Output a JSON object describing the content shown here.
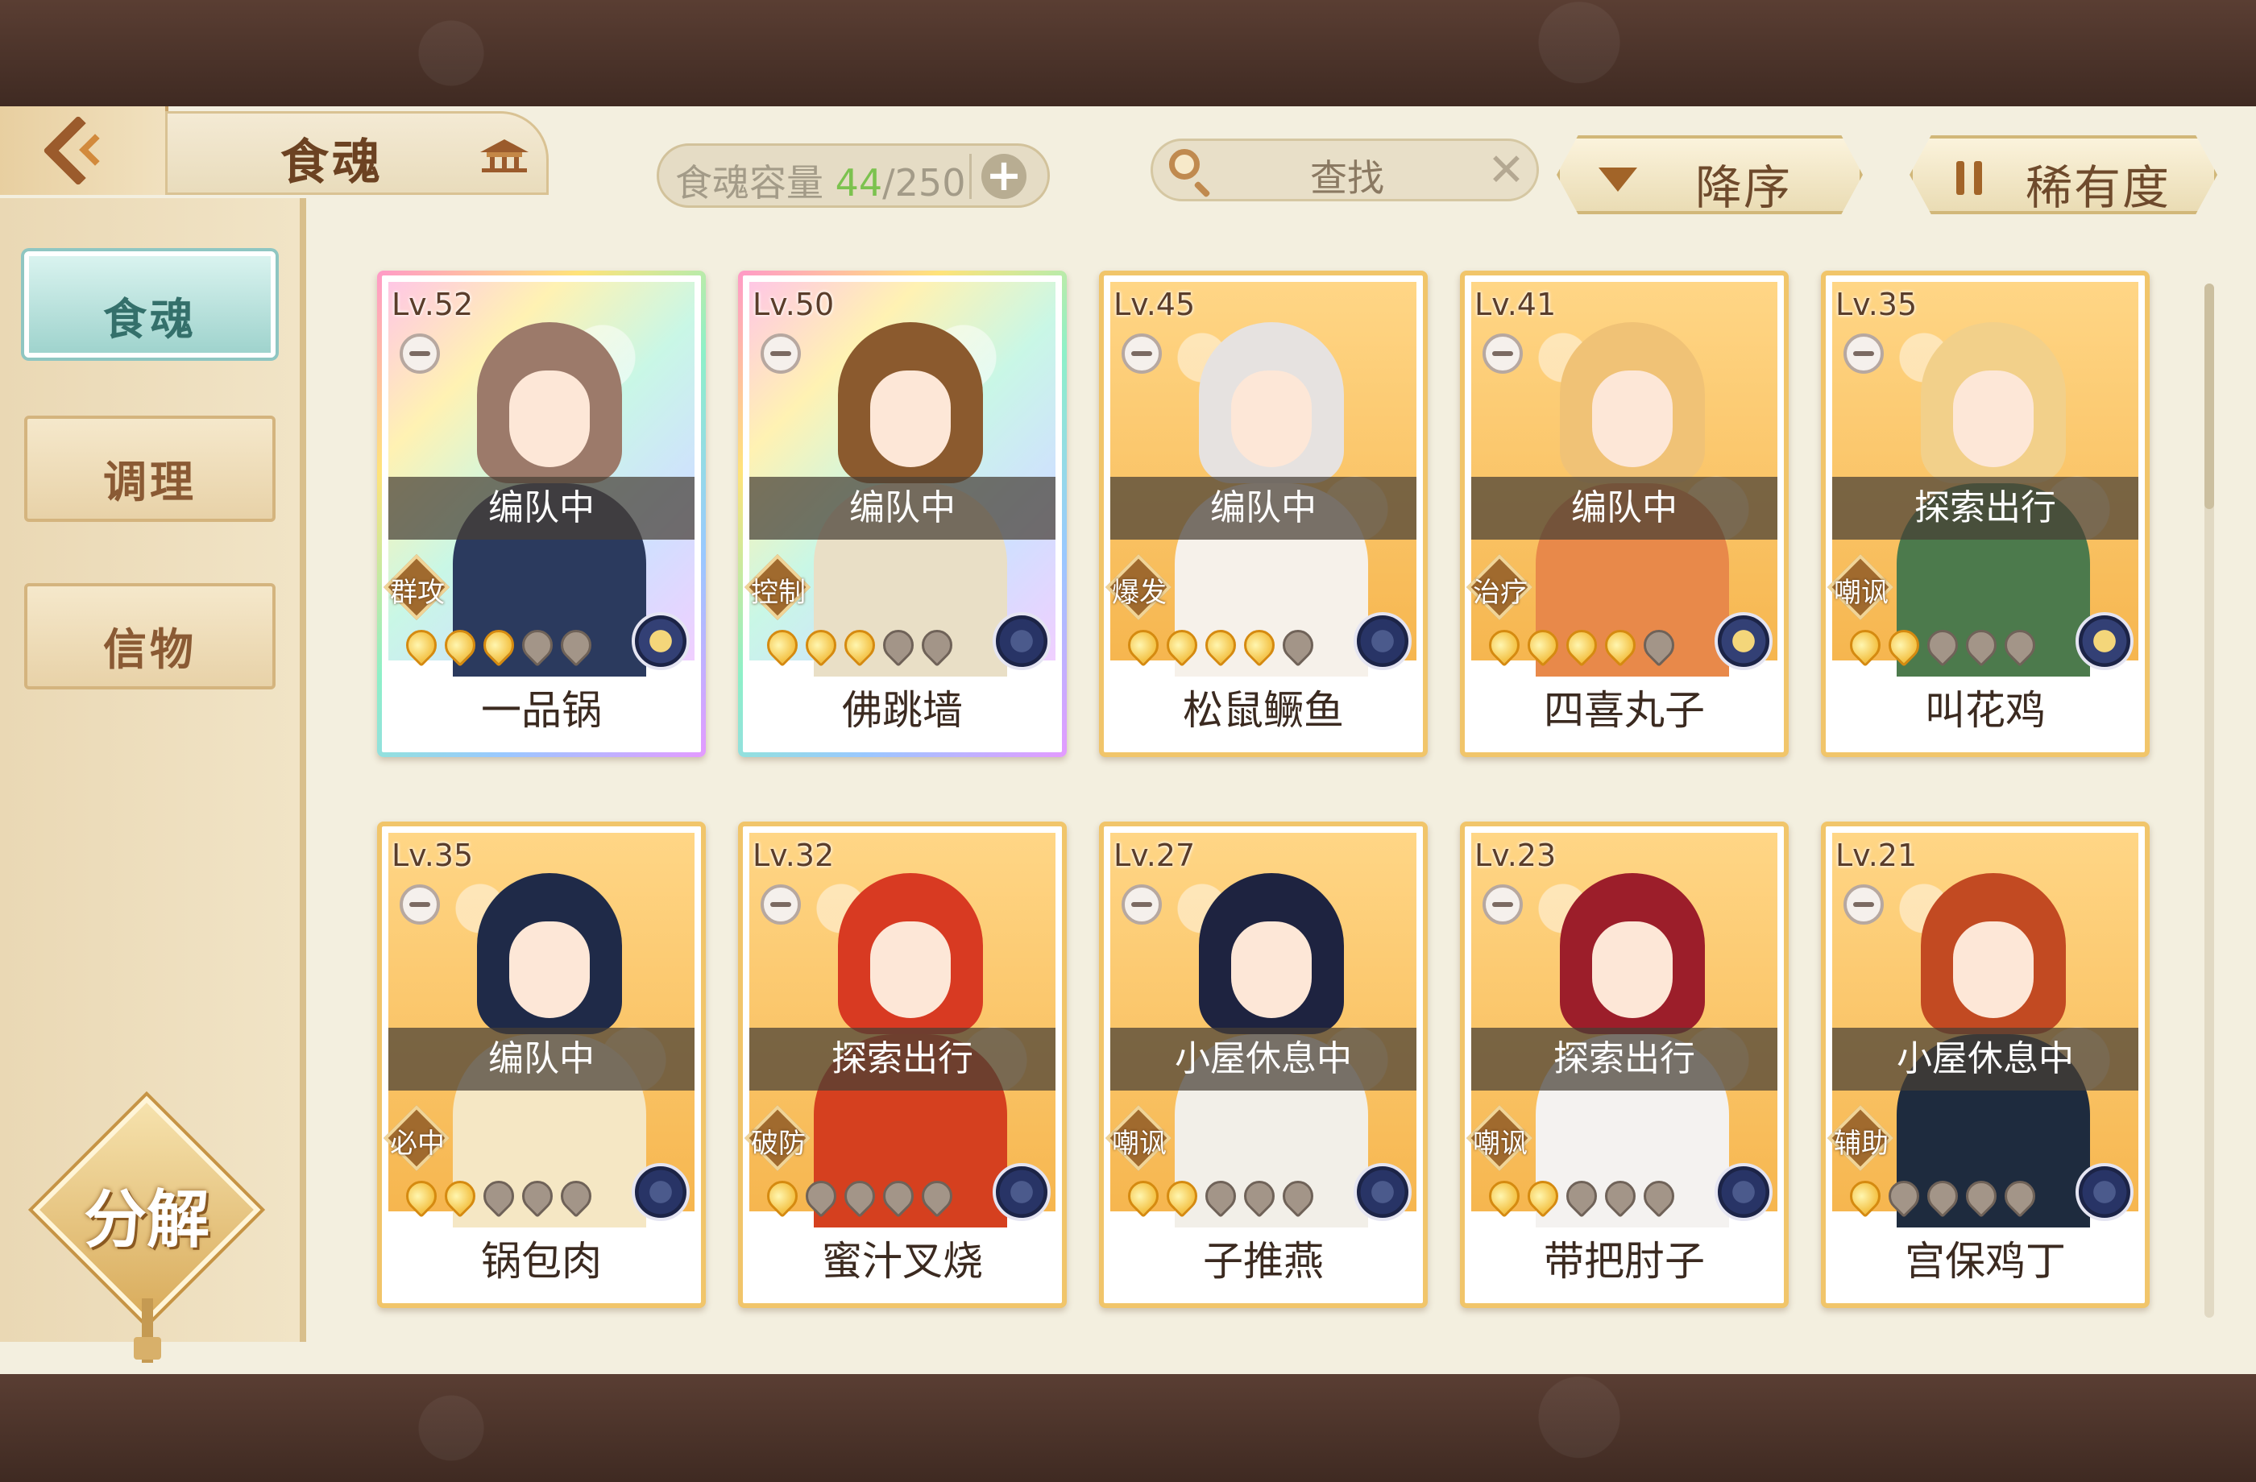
{
  "header": {
    "title": "食魂",
    "capacity_label": "食魂容量",
    "capacity_current": "44",
    "capacity_total": "/250",
    "capacity_add": "+",
    "search_placeholder": "查找",
    "search_clear": "✕",
    "sort_order": "降序",
    "sort_key": "稀有度"
  },
  "sidebar": {
    "items": [
      {
        "label": "食魂",
        "active": true
      },
      {
        "label": "调理",
        "active": false
      },
      {
        "label": "信物",
        "active": false
      }
    ],
    "decompose": "分解"
  },
  "cards": [
    {
      "level": "Lv.52",
      "status": "编队中",
      "role": "群攻",
      "stars": 3,
      "name": "一品锅",
      "frame": "rainbow",
      "emblem": "gold",
      "hair": "#9c7a6a",
      "body": "#2b3a5e"
    },
    {
      "level": "Lv.50",
      "status": "编队中",
      "role": "控制",
      "stars": 3,
      "name": "佛跳墙",
      "frame": "rainbow",
      "emblem": "blue",
      "hair": "#8b5a2e",
      "body": "#e9dfc6"
    },
    {
      "level": "Lv.45",
      "status": "编队中",
      "role": "爆发",
      "stars": 4,
      "name": "松鼠鳜鱼",
      "frame": "gold",
      "emblem": "blue",
      "hair": "#e6e2e0",
      "body": "#f6f1ea"
    },
    {
      "level": "Lv.41",
      "status": "编队中",
      "role": "治疗",
      "stars": 4,
      "name": "四喜丸子",
      "frame": "gold",
      "emblem": "gold",
      "hair": "#f0c276",
      "body": "#e8894a"
    },
    {
      "level": "Lv.35",
      "status": "探索出行",
      "role": "嘲讽",
      "stars": 2,
      "name": "叫花鸡",
      "frame": "gold",
      "emblem": "gold",
      "hair": "#f2d08a",
      "body": "#4c7a4c"
    },
    {
      "level": "Lv.35",
      "status": "编队中",
      "role": "必中",
      "stars": 2,
      "name": "锅包肉",
      "frame": "gold",
      "emblem": "blue",
      "hair": "#1f2a48",
      "body": "#f5e7c4"
    },
    {
      "level": "Lv.32",
      "status": "探索出行",
      "role": "破防",
      "stars": 1,
      "name": "蜜汁叉烧",
      "frame": "gold",
      "emblem": "blue",
      "hair": "#d83a22",
      "body": "#d5401f"
    },
    {
      "level": "Lv.27",
      "status": "小屋休息中",
      "role": "嘲讽",
      "stars": 2,
      "name": "子推燕",
      "frame": "gold",
      "emblem": "blue",
      "hair": "#1e2340",
      "body": "#f2efe8"
    },
    {
      "level": "Lv.23",
      "status": "探索出行",
      "role": "嘲讽",
      "stars": 2,
      "name": "带把肘子",
      "frame": "gold",
      "emblem": "blue",
      "hair": "#9c1e2a",
      "body": "#f4f2f0"
    },
    {
      "level": "Lv.21",
      "status": "小屋休息中",
      "role": "辅助",
      "stars": 1,
      "name": "宫保鸡丁",
      "frame": "gold",
      "emblem": "blue",
      "hair": "#c24a22",
      "body": "#1e2b3e"
    }
  ]
}
